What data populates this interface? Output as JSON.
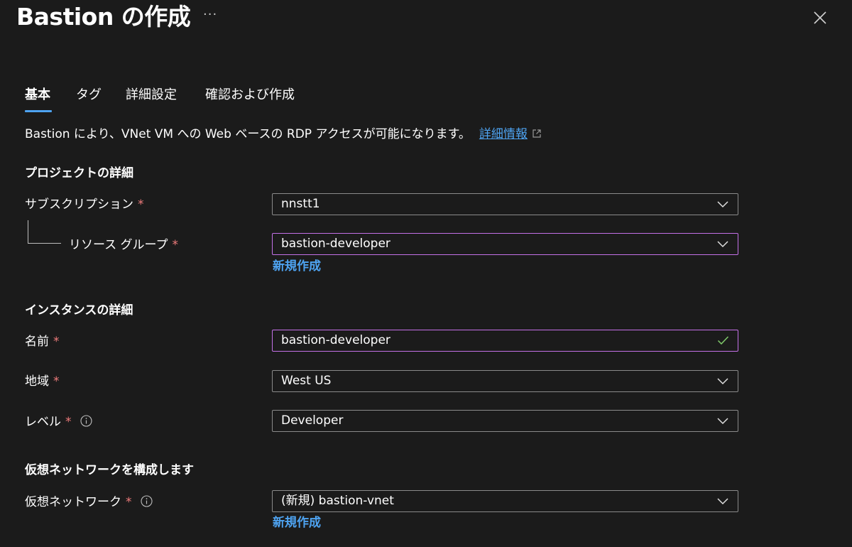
{
  "header": {
    "title": "Bastion の作成",
    "more_label": "···"
  },
  "tabs": [
    {
      "label": "基本",
      "active": true
    },
    {
      "label": "タグ",
      "active": false
    },
    {
      "label": "詳細設定",
      "active": false
    },
    {
      "label": "確認および作成",
      "active": false
    }
  ],
  "description": {
    "text": "Bastion により、VNet VM への Web ベースの RDP アクセスが可能になります。",
    "link": "詳細情報"
  },
  "sections": {
    "project": "プロジェクトの詳細",
    "instance": "インスタンスの詳細",
    "network": "仮想ネットワークを構成します"
  },
  "required_mark": "*",
  "fields": {
    "subscription": {
      "label": "サブスクリプション",
      "value": "nnstt1"
    },
    "resource_group": {
      "label": "リソース グループ",
      "value": "bastion-developer",
      "create_new": "新規作成"
    },
    "name": {
      "label": "名前",
      "value": "bastion-developer"
    },
    "region": {
      "label": "地域",
      "value": "West US"
    },
    "tier": {
      "label": "レベル",
      "value": "Developer"
    },
    "vnet": {
      "label": "仮想ネットワーク",
      "value": "(新規) bastion-vnet",
      "create_new": "新規作成"
    }
  },
  "colors": {
    "background": "#1b1b1b",
    "accent": "#4ea3f1",
    "focus_border": "#c471e8",
    "required": "#ee7b7b",
    "valid_check": "#7fc86a"
  }
}
